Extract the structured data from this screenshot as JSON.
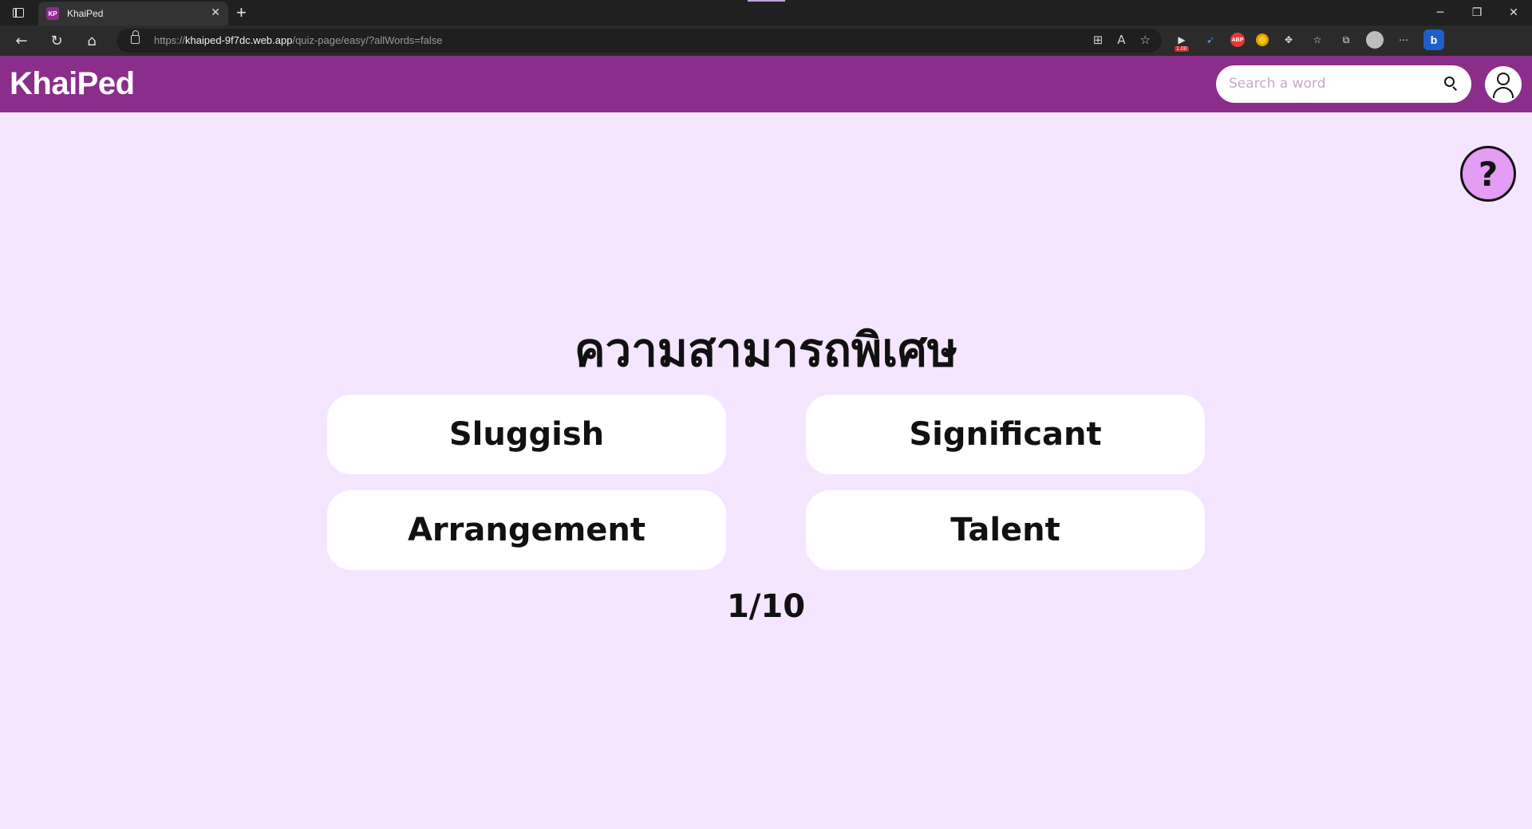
{
  "browser": {
    "tab_title": "KhaiPed",
    "favicon_text": "KP",
    "url_domain": "khaiped-9f7dc.web.app",
    "url_scheme": "https://",
    "url_path": "/quiz-page/easy/?allWords=false",
    "extension_badge": "1.00",
    "abp_label": "ABP",
    "bing_label": "b"
  },
  "header": {
    "logo": "KhaiPed",
    "search_placeholder": "Search a word",
    "brand_color": "#8b2d8b"
  },
  "help": {
    "label": "?"
  },
  "quiz": {
    "question": "ความสามารถพิเศษ",
    "answers": [
      "Sluggish",
      "Significant",
      "Arrangement",
      "Talent"
    ],
    "progress": "1/10"
  },
  "colors": {
    "page_bg": "#f5e5ff",
    "help_bg": "#e59cf5",
    "answer_bg": "#ffffff"
  }
}
